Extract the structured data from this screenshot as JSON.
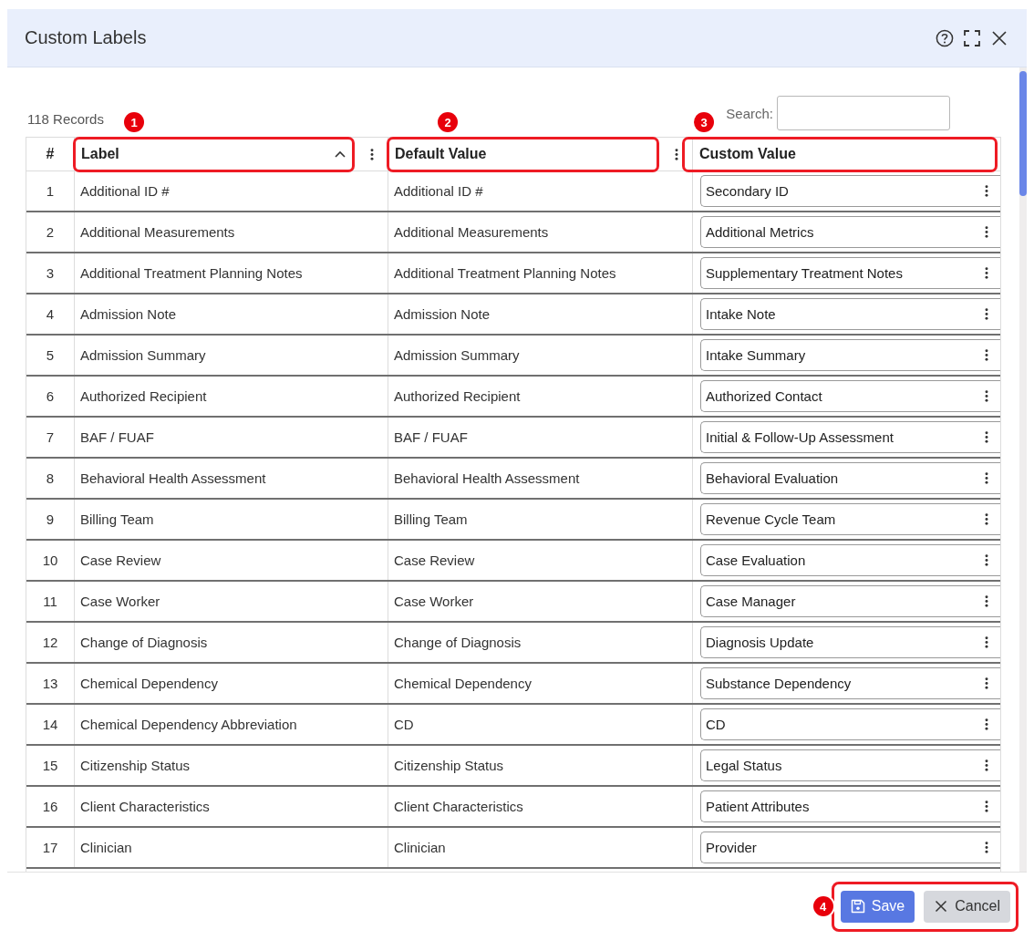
{
  "dialog": {
    "title": "Custom Labels"
  },
  "toolbar": {
    "records": "118 Records",
    "search": {
      "label": "Search:"
    }
  },
  "table": {
    "columns": [
      {
        "label": "#",
        "kind": "index",
        "menu": false
      },
      {
        "label": "Label",
        "kind": "text",
        "sort_ascending": true,
        "menu": true,
        "callout": "1"
      },
      {
        "label": "Default Value",
        "kind": "text",
        "menu": true,
        "callout": "2"
      },
      {
        "label": "Custom Value",
        "kind": "input",
        "menu": false,
        "callout": "3"
      }
    ],
    "rows": [
      {
        "cells": [
          "1",
          "Additional ID #",
          "Additional ID #",
          "Secondary ID"
        ]
      },
      {
        "cells": [
          "2",
          "Additional Measurements",
          "Additional Measurements",
          "Additional Metrics"
        ]
      },
      {
        "cells": [
          "3",
          "Additional Treatment Planning Notes",
          "Additional Treatment Planning Notes",
          "Supplementary Treatment Notes"
        ]
      },
      {
        "cells": [
          "4",
          "Admission Note",
          "Admission Note",
          "Intake Note"
        ]
      },
      {
        "cells": [
          "5",
          "Admission Summary",
          "Admission Summary",
          "Intake Summary"
        ]
      },
      {
        "cells": [
          "6",
          "Authorized Recipient",
          "Authorized Recipient",
          "Authorized Contact"
        ]
      },
      {
        "cells": [
          "7",
          "BAF / FUAF",
          "BAF / FUAF",
          "Initial & Follow-Up Assessment"
        ]
      },
      {
        "cells": [
          "8",
          "Behavioral Health Assessment",
          "Behavioral Health Assessment",
          "Behavioral Evaluation"
        ]
      },
      {
        "cells": [
          "9",
          "Billing Team",
          "Billing Team",
          "Revenue Cycle Team"
        ]
      },
      {
        "cells": [
          "10",
          "Case Review",
          "Case Review",
          "Case Evaluation"
        ]
      },
      {
        "cells": [
          "11",
          "Case Worker",
          "Case Worker",
          "Case Manager"
        ]
      },
      {
        "cells": [
          "12",
          "Change of Diagnosis",
          "Change of Diagnosis",
          "Diagnosis Update"
        ]
      },
      {
        "cells": [
          "13",
          "Chemical Dependency",
          "Chemical Dependency",
          "Substance Dependency"
        ]
      },
      {
        "cells": [
          "14",
          "Chemical Dependency Abbreviation",
          "CD",
          "CD"
        ]
      },
      {
        "cells": [
          "15",
          "Citizenship Status",
          "Citizenship Status",
          "Legal Status"
        ]
      },
      {
        "cells": [
          "16",
          "Client Characteristics",
          "Client Characteristics",
          "Patient Attributes"
        ]
      },
      {
        "cells": [
          "17",
          "Clinician",
          "Clinician",
          "Provider"
        ]
      }
    ]
  },
  "footer": {
    "callout": "4",
    "buttons": [
      {
        "label": "Save",
        "kind": "primary"
      },
      {
        "label": "Cancel",
        "kind": "secondary"
      }
    ]
  }
}
